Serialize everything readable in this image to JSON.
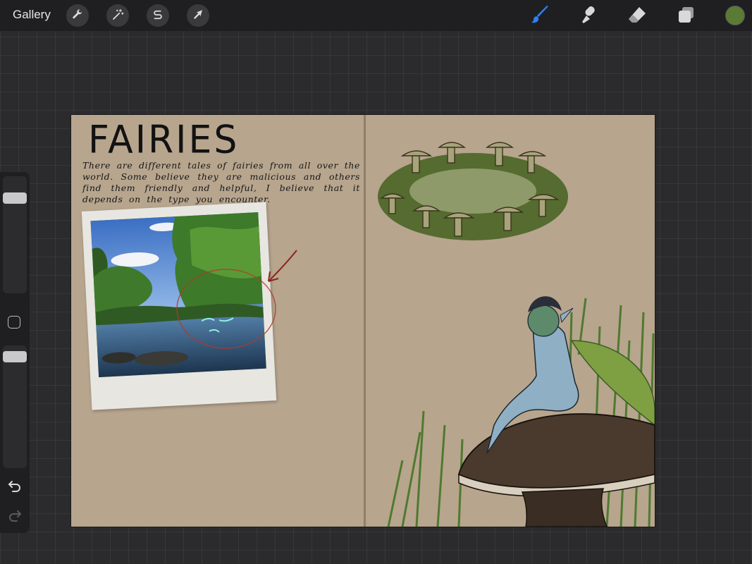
{
  "toolbar": {
    "gallery_label": "Gallery",
    "left_tools": [
      {
        "icon": "wrench-icon",
        "name": "actions"
      },
      {
        "icon": "magic-wand-icon",
        "name": "adjustments"
      },
      {
        "icon": "selection-s-icon",
        "name": "selection"
      },
      {
        "icon": "arrow-cursor-icon",
        "name": "transform"
      }
    ],
    "right_tools": [
      {
        "icon": "brush-icon",
        "name": "paint",
        "active": true
      },
      {
        "icon": "smudge-icon",
        "name": "smudge"
      },
      {
        "icon": "eraser-icon",
        "name": "eraser"
      },
      {
        "icon": "layers-icon",
        "name": "layers"
      }
    ],
    "current_color": "#5a7a35",
    "active_tool_color": "#2f7ff0"
  },
  "sidebar": {
    "brush_size_thumb": 0.85,
    "opacity_thumb": 0.95
  },
  "canvas": {
    "title": "FAIRIES",
    "body_text": "There are different tales of fairies from all over the world. Some believe they are malicious and others find them friendly and helpful, I believe that it depends on the type you encounter."
  }
}
